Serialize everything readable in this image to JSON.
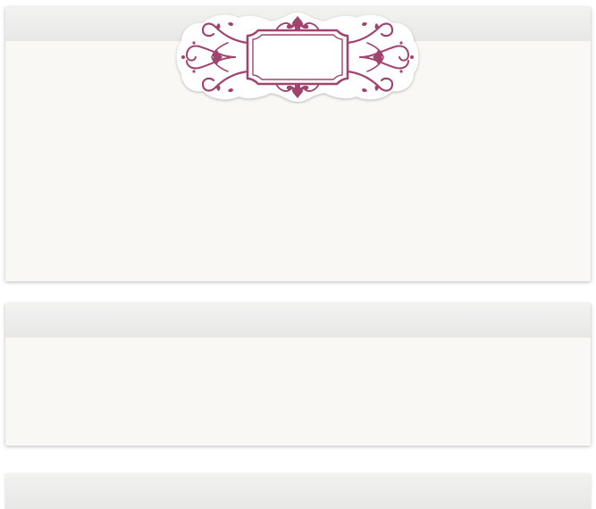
{
  "colors": {
    "panel_background": "#f9f8f4",
    "header_background": "#ececeb",
    "ornament_accent": "#a0446f",
    "ornament_backing": "#ffffff"
  },
  "panels": [
    {
      "name": "content-panel-top",
      "title": ""
    },
    {
      "name": "content-panel-middle",
      "title": ""
    },
    {
      "name": "content-panel-bottom",
      "title": ""
    }
  ],
  "ornament": {
    "icon": "decorative-frame-icon",
    "label": ""
  }
}
